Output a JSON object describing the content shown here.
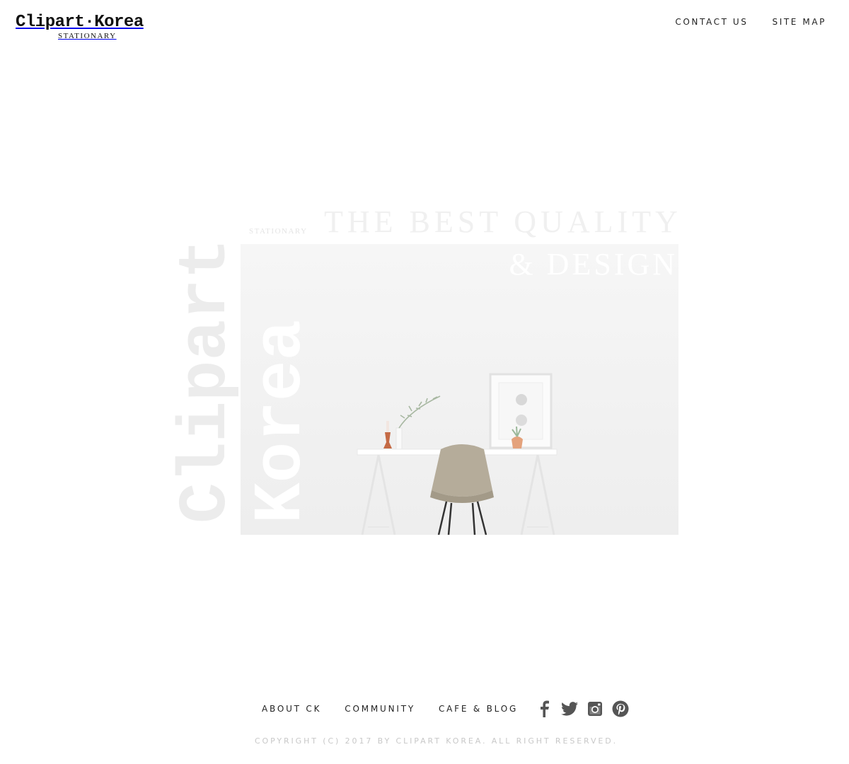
{
  "header": {
    "logo_main": "Clipart·Korea",
    "logo_sub": "STATIONARY",
    "nav": [
      "CONTACT US",
      "SITE MAP"
    ]
  },
  "hero": {
    "tagline_line1": "THE BEST QUALITY",
    "tagline_line2": "& DESIGN",
    "small_label": "STATIONARY",
    "vertical_word_1": "Clipart",
    "vertical_word_2": "Korea"
  },
  "footer": {
    "nav": [
      "ABOUT CK",
      "COMMUNITY",
      "CAFE & BLOG"
    ],
    "social_icons": [
      "facebook-icon",
      "twitter-icon",
      "instagram-icon",
      "pinterest-icon"
    ],
    "copyright": "COPYRIGHT (C) 2017 BY CLIPART KOREA. ALL RIGHT RESERVED."
  },
  "colors": {
    "text": "#222222",
    "icon": "#555555",
    "muted": "#c8c8c8",
    "background": "#ffffff"
  }
}
